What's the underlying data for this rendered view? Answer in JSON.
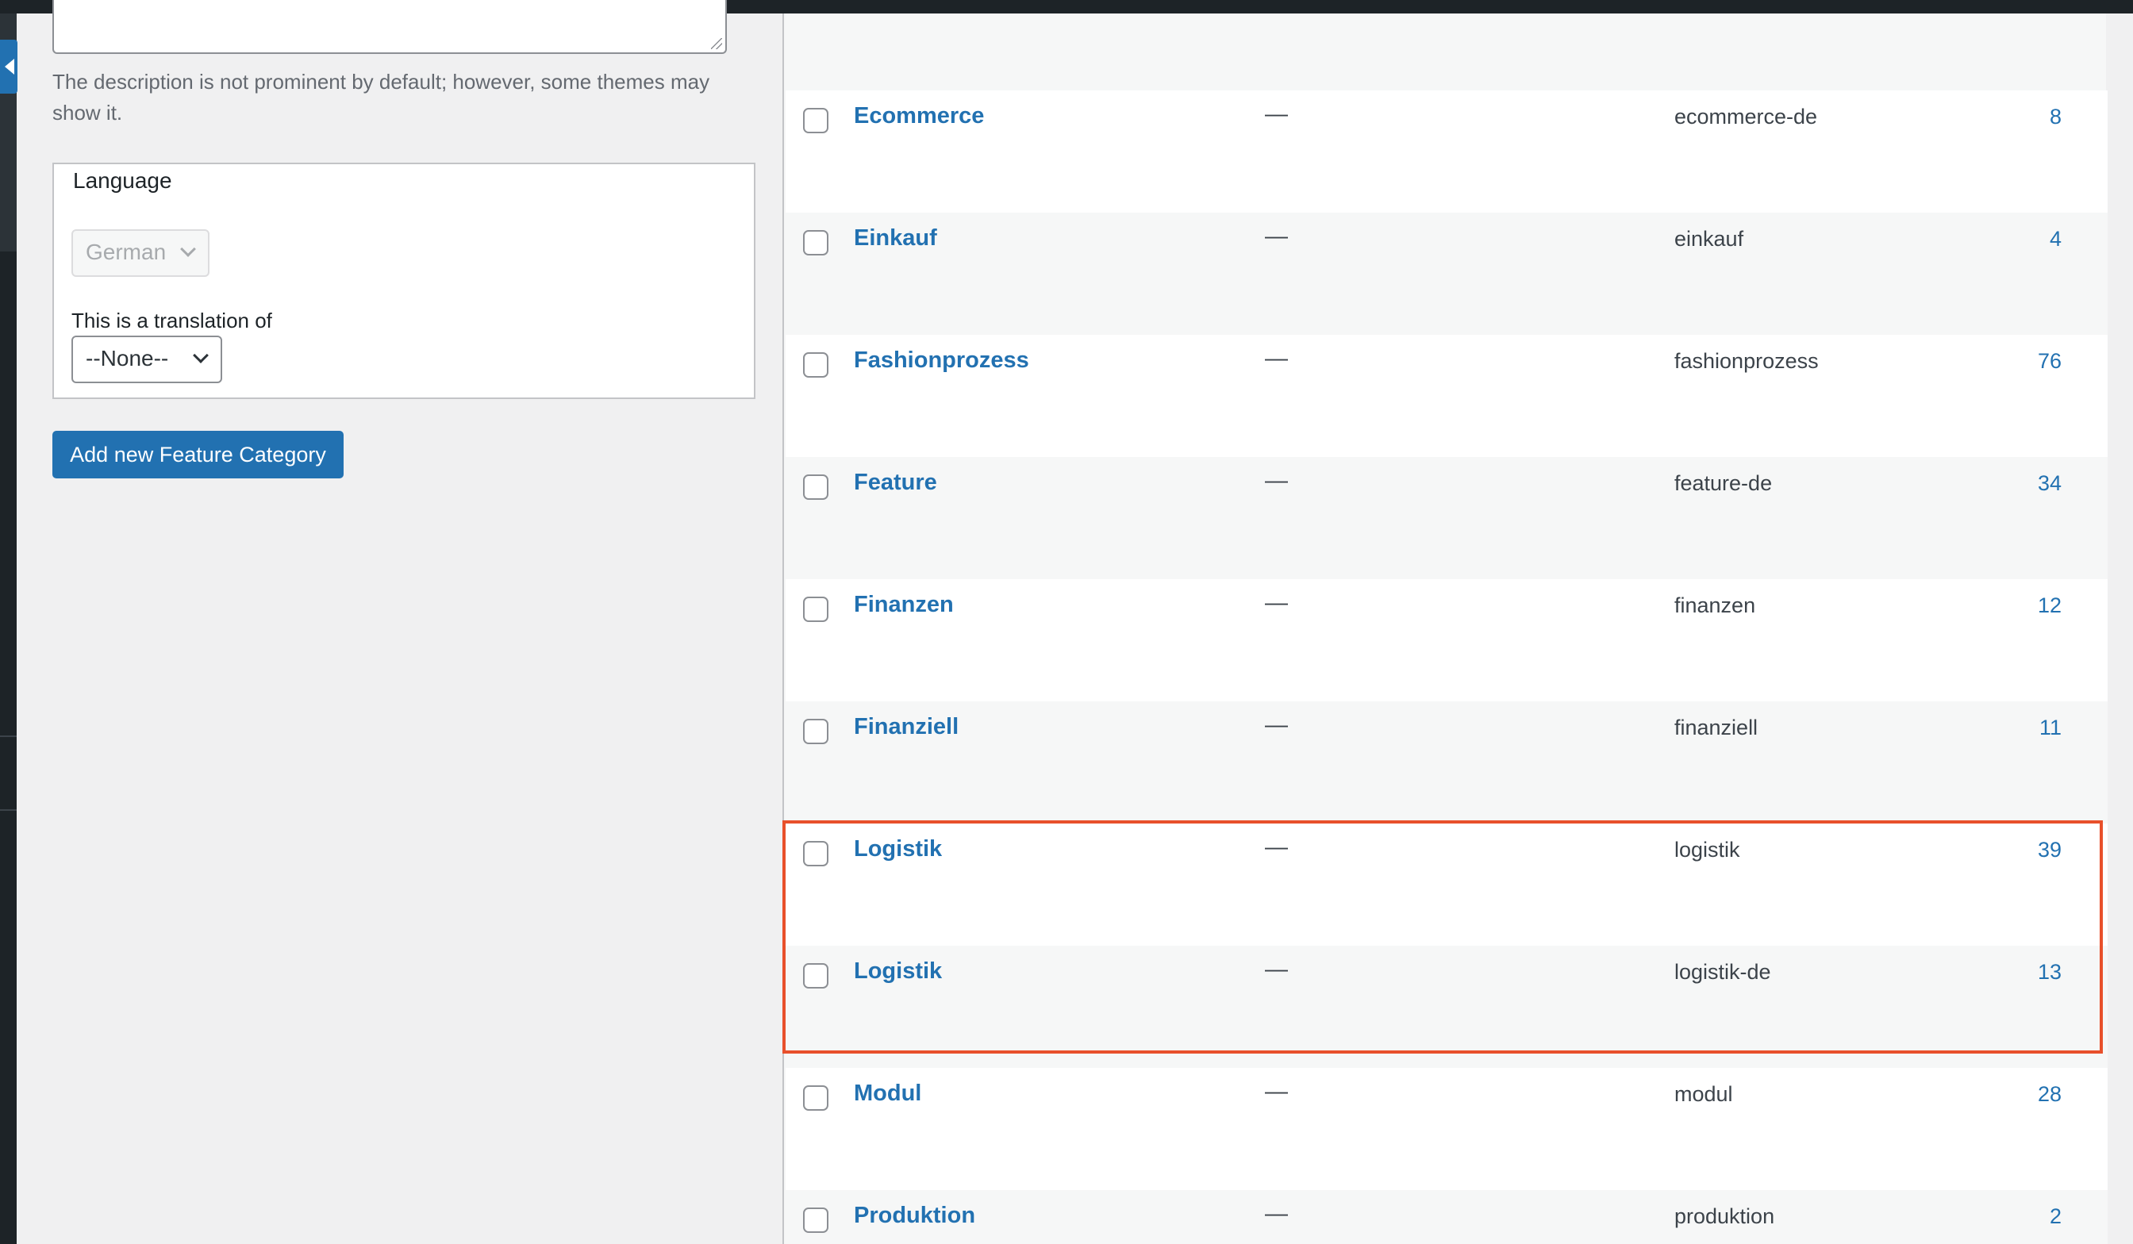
{
  "form": {
    "description_help": "The description is not prominent by default; however, some themes may show it.",
    "language_label": "Language",
    "language_value": "German",
    "translation_label": "This is a translation of",
    "translation_value": "--None--",
    "add_button_label": "Add new Feature Category"
  },
  "table": {
    "rows": [
      {
        "name": "Ecommerce",
        "description": "—",
        "slug": "ecommerce-de",
        "count": "8"
      },
      {
        "name": "Einkauf",
        "description": "—",
        "slug": "einkauf",
        "count": "4"
      },
      {
        "name": "Fashionprozess",
        "description": "—",
        "slug": "fashionprozess",
        "count": "76"
      },
      {
        "name": "Feature",
        "description": "—",
        "slug": "feature-de",
        "count": "34"
      },
      {
        "name": "Finanzen",
        "description": "—",
        "slug": "finanzen",
        "count": "12"
      },
      {
        "name": "Finanziell",
        "description": "—",
        "slug": "finanziell",
        "count": "11"
      },
      {
        "name": "Logistik",
        "description": "—",
        "slug": "logistik",
        "count": "39"
      },
      {
        "name": "Logistik",
        "description": "—",
        "slug": "logistik-de",
        "count": "13"
      },
      {
        "name": "Modul",
        "description": "—",
        "slug": "modul",
        "count": "28"
      },
      {
        "name": "Produktion",
        "description": "—",
        "slug": "produktion",
        "count": "2"
      }
    ]
  },
  "colors": {
    "accent": "#2271b1",
    "highlight": "#e8502b",
    "admin_bar": "#1d2327"
  }
}
